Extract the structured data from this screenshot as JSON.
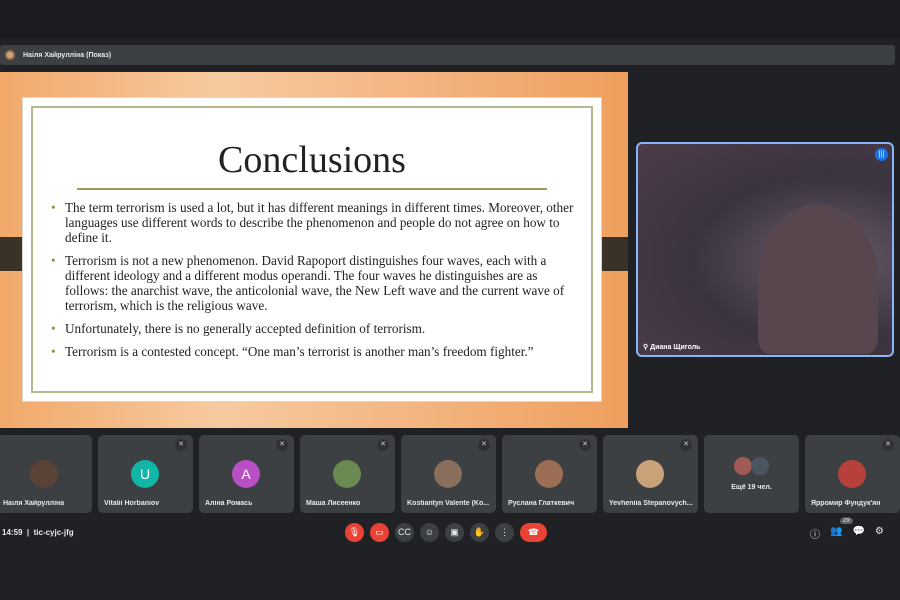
{
  "presenter": {
    "label": "Наіля Хайрулліна (Показ)"
  },
  "slide": {
    "title": "Conclusions",
    "bullets": [
      "The term terrorism is used a lot, but it has different meanings in different times. Moreover, other languages use different words to describe the phenomenon and people do not agree on how to define it.",
      "Terrorism is not a new phenomenon. David Rapoport distinguishes four waves, each with a different ideology and a different modus operandi. The four waves he distinguishes are as follows: the anarchist wave, the anticolonial wave, the New Left wave and the current wave of terrorism, which is the religious wave.",
      " Unfortunately, there is no generally accepted definition of terrorism.",
      "Terrorism is a contested concept. “One man’s terrorist is another man’s freedom fighter.”"
    ]
  },
  "self_view": {
    "name": "Диана Щиголь"
  },
  "participants": [
    {
      "name": "Наіля Хайрулліна",
      "avatar": "photo",
      "color": "#5a4236"
    },
    {
      "name": "Vitalii Horbaniov",
      "avatar": "U",
      "color": "#12b5a6"
    },
    {
      "name": "Аліна Ромась",
      "avatar": "A",
      "color": "#b84fc4"
    },
    {
      "name": "Маша Лисеенко",
      "avatar": "photo",
      "color": "#6b8a52"
    },
    {
      "name": "Kostiantyn Valente (Ko...",
      "avatar": "photo",
      "color": "#8a6f5c"
    },
    {
      "name": "Руслана Глаткевич",
      "avatar": "photo",
      "color": "#9c6e55"
    },
    {
      "name": "Yevheniia Stepanovych...",
      "avatar": "photo",
      "color": "#c9a27a"
    },
    {
      "name": "Ярромир Фундук'ян",
      "avatar": "photo",
      "color": "#b8403a"
    }
  ],
  "more": {
    "label": "Ещё 19 чел."
  },
  "meeting": {
    "time": "14:59",
    "code": "tic-cyjc-jfg"
  },
  "people_count": "29"
}
